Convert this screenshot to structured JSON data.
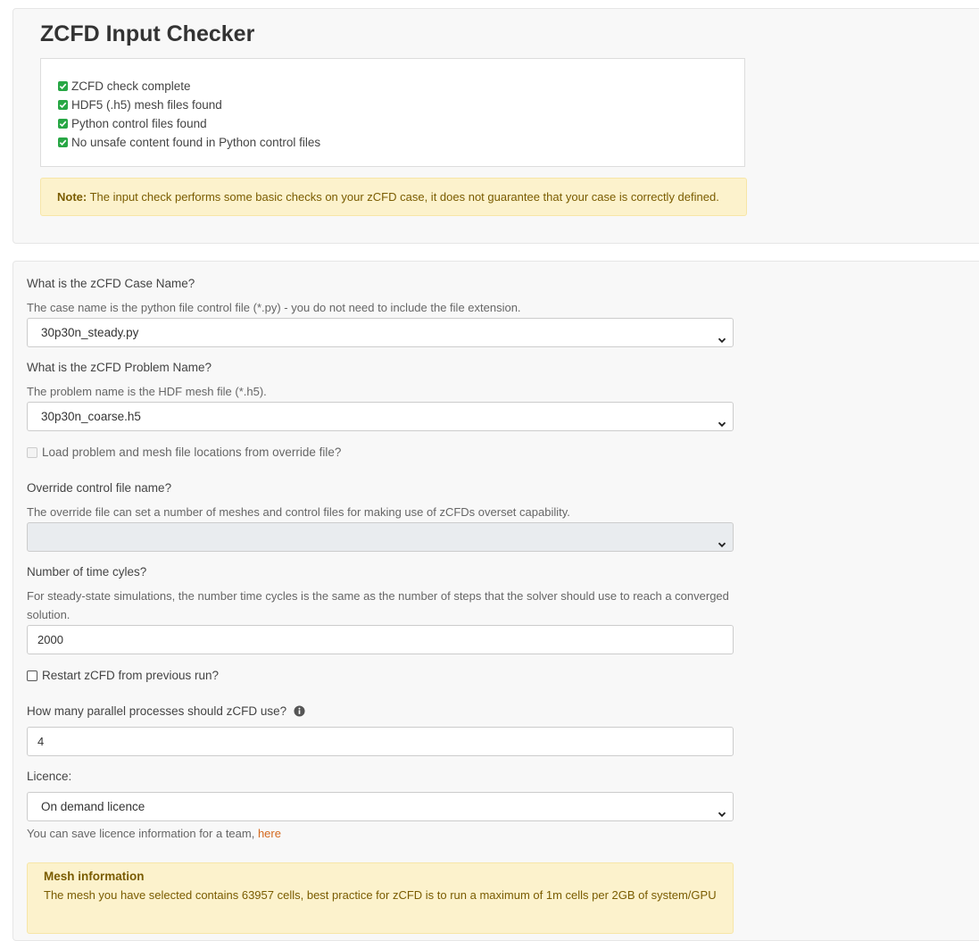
{
  "checker": {
    "title": "ZCFD Input Checker",
    "checks": [
      "ZCFD check complete",
      "HDF5 (.h5) mesh files found",
      "Python control files found",
      "No unsafe content found in Python control files"
    ],
    "note_label": "Note:",
    "note_text": " The input check performs some basic checks on your zCFD case, it does not guarantee that your case is correctly defined."
  },
  "form": {
    "case_name_label": "What is the zCFD Case Name?",
    "case_name_help": "The case name is the python file control file (*.py) - you do not need to include the file extension.",
    "case_name_value": "30p30n_steady.py",
    "problem_name_label": "What is the zCFD Problem Name?",
    "problem_name_help": "The problem name is the HDF mesh file (*.h5).",
    "problem_name_value": "30p30n_coarse.h5",
    "override_checkbox_label": "Load problem and mesh file locations from override file?",
    "override_name_label": "Override control file name?",
    "override_name_help": "The override file can set a number of meshes and control files for making use of zCFDs overset capability.",
    "override_name_value": "",
    "time_cycles_label": "Number of time cyles?",
    "time_cycles_help": "For steady-state simulations, the number time cycles is the same as the number of steps that the solver should use to reach a converged solution.",
    "time_cycles_value": "2000",
    "restart_label": "Restart zCFD from previous run?",
    "parallel_label": "How many parallel processes should zCFD use?",
    "parallel_value": "4",
    "licence_label": "Licence:",
    "licence_value": "On demand licence",
    "licence_help": "You can save licence information for a team, ",
    "licence_link": "here",
    "mesh_info_title": "Mesh information",
    "mesh_info_text": "The mesh you have selected contains 63957 cells, best practice for zCFD is to run a maximum of 1m cells per 2GB of system/GPU"
  },
  "icons": {
    "check": "checkbox-checked-icon",
    "chevron": "chevron-down-icon",
    "info": "info-circle-icon"
  },
  "colors": {
    "success": "#28a745",
    "warning_bg": "#fcf2cc",
    "warning_text": "#7a5c00",
    "link": "#d46a1f"
  }
}
